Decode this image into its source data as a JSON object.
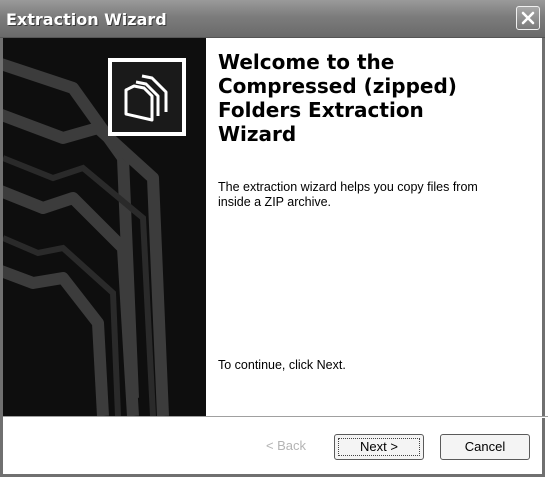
{
  "window": {
    "title": "Extraction Wizard"
  },
  "side_panel": {
    "icon": "zipped-folder-icon"
  },
  "content": {
    "heading": "Welcome to the\nCompressed (zipped)\nFolders Extraction\nWizard",
    "description": "The extraction wizard helps you copy files from inside a ZIP archive.",
    "continue_text": "To continue, click Next."
  },
  "buttons": {
    "back_label": "< Back",
    "next_label": "Next >",
    "cancel_label": "Cancel"
  }
}
